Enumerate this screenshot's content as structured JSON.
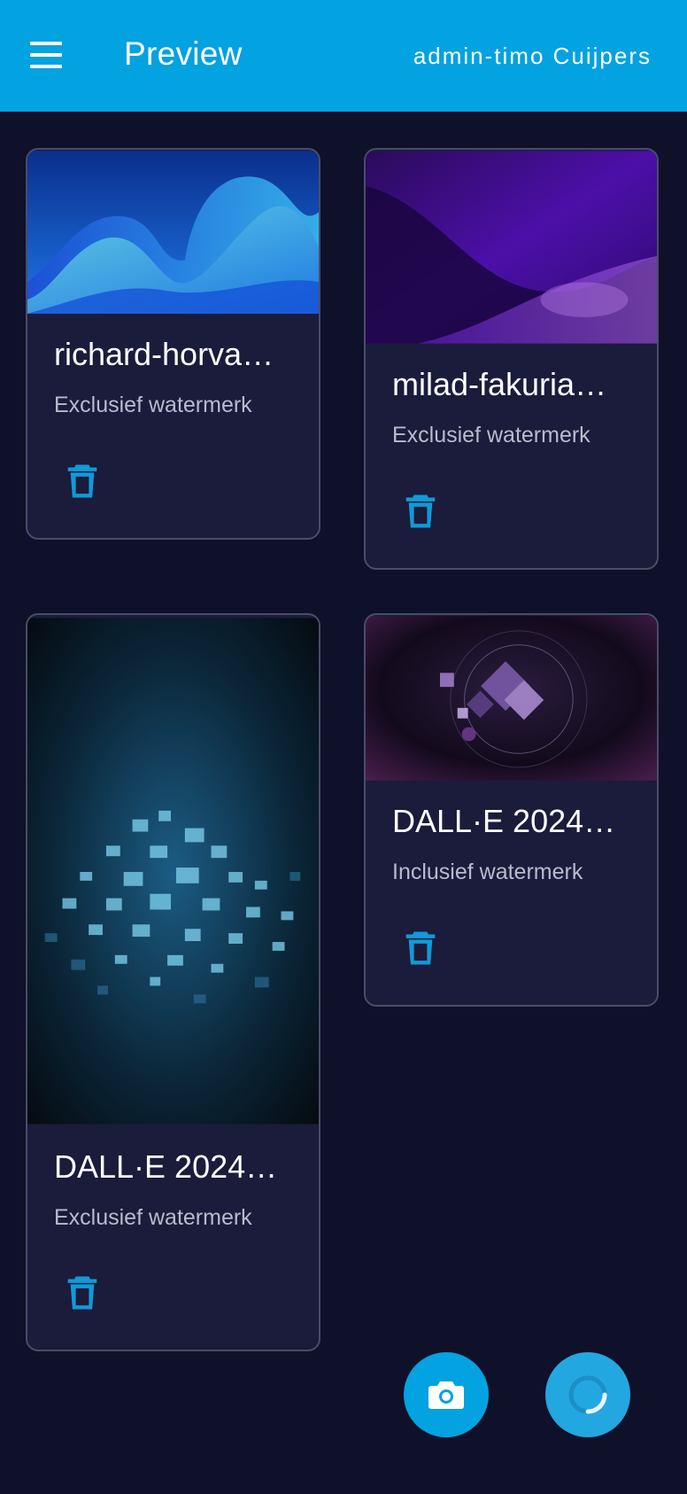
{
  "appbar": {
    "title": "Preview",
    "user": "admin-timo Cuijpers",
    "menu_icon": "hamburger-menu-icon",
    "color": "#03a2e0"
  },
  "cards": [
    {
      "title": "richard-horva…",
      "watermark": "Exclusief watermerk",
      "icon": "trash-icon"
    },
    {
      "title": "milad-fakuria…",
      "watermark": "Exclusief watermerk",
      "icon": "trash-icon"
    },
    {
      "title": "DALL·E 2024…",
      "watermark": "Exclusief watermerk",
      "icon": "trash-icon"
    },
    {
      "title": "DALL·E 2024…",
      "watermark": "Inclusief watermerk",
      "icon": "trash-icon"
    }
  ],
  "fabs": {
    "camera_icon": "camera-icon",
    "loading_icon": "loading-spinner-icon"
  },
  "colors": {
    "background": "#0f1029",
    "card": "#1b1b3b",
    "accent": "#03a2e0"
  }
}
